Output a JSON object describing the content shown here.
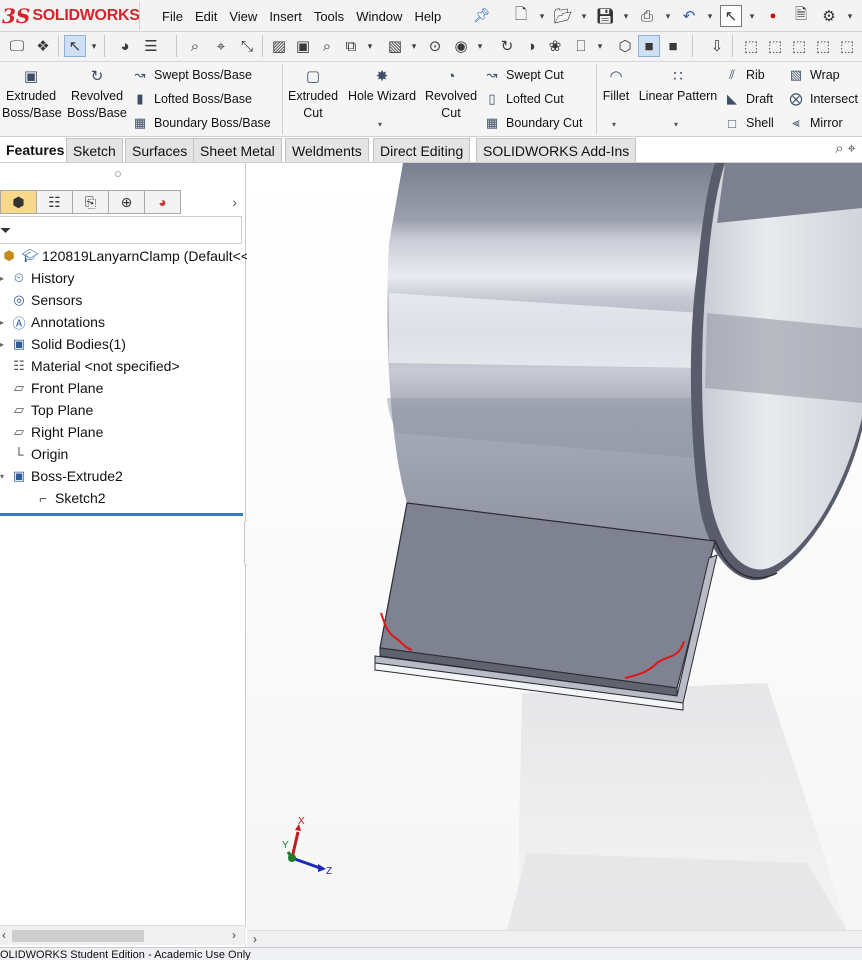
{
  "app": {
    "logo": "SOLIDWORKS",
    "logo_mark": "3S"
  },
  "menu": [
    "File",
    "Edit",
    "View",
    "Insert",
    "Tools",
    "Window",
    "Help"
  ],
  "ribbon": {
    "extruded_boss": "Extruded Boss/Base",
    "revolved_boss": "Revolved Boss/Base",
    "swept_boss": "Swept Boss/Base",
    "lofted_boss": "Lofted Boss/Base",
    "boundary_boss": "Boundary Boss/Base",
    "extruded_cut": "Extruded Cut",
    "hole_wizard": "Hole Wizard",
    "revolved_cut": "Revolved Cut",
    "swept_cut": "Swept Cut",
    "lofted_cut": "Lofted Cut",
    "boundary_cut": "Boundary Cut",
    "fillet": "Fillet",
    "linear_pattern": "Linear Pattern",
    "rib": "Rib",
    "draft": "Draft",
    "shell": "Shell",
    "wrap": "Wrap",
    "intersect": "Intersect",
    "mirror": "Mirror"
  },
  "tabs": [
    "Features",
    "Sketch",
    "Surfaces",
    "Sheet Metal",
    "Weldments",
    "Direct Editing",
    "SOLIDWORKS Add-Ins"
  ],
  "tree": {
    "root": "120819LanyarnClamp  (Default<<",
    "items": [
      {
        "label": "History"
      },
      {
        "label": "Sensors"
      },
      {
        "label": "Annotations"
      },
      {
        "label": "Solid Bodies(1)"
      },
      {
        "label": "Material <not specified>"
      },
      {
        "label": "Front Plane"
      },
      {
        "label": "Top Plane"
      },
      {
        "label": "Right Plane"
      },
      {
        "label": "Origin"
      },
      {
        "label": "Boss-Extrude2"
      },
      {
        "label": "Sketch2"
      }
    ]
  },
  "triad": {
    "x": "X",
    "y": "Y",
    "z": "Z"
  },
  "status": "OLIDWORKS Student Edition - Academic Use Only"
}
